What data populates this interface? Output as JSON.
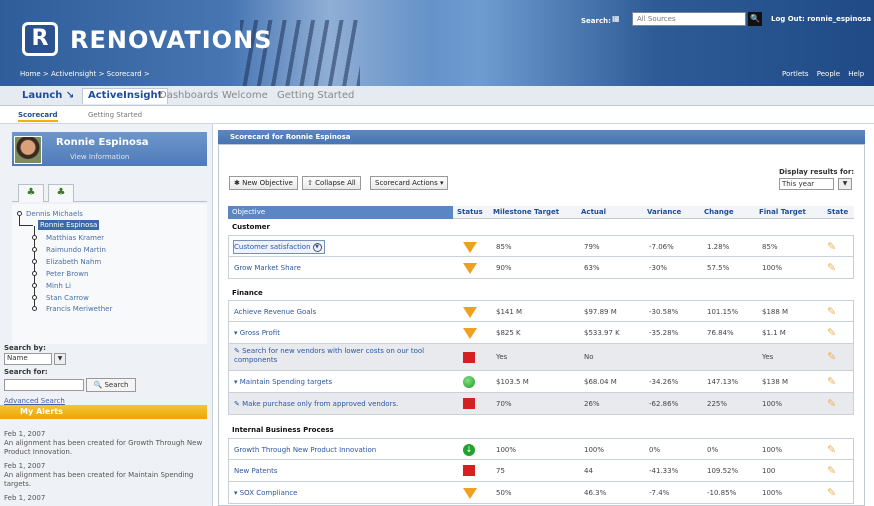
{
  "header": {
    "logo_letter": "R",
    "logo_text": "RENOVATIONS",
    "breadcrumb": "Home > ActiveInsight > Scorecard >",
    "search_label": "Search:",
    "search_placeholder": "All Sources",
    "logout": "Log Out: ronnie_espinosa",
    "links": [
      "Portlets",
      "People",
      "Help"
    ]
  },
  "tabs": {
    "launch": "Launch ↘",
    "items": [
      "ActiveInsight",
      "Dashboards",
      "Welcome",
      "Getting Started"
    ],
    "sub": [
      "Scorecard",
      "Getting Started"
    ]
  },
  "profile": {
    "name": "Ronnie Espinosa",
    "sub": "View Information"
  },
  "tree": {
    "root": "Dennis Michaels",
    "selected": "Ronnie Espinosa",
    "children": [
      "Matthias Kramer",
      "Raimundo Martin",
      "Elizabeth Nahm",
      "Peter Brown",
      "Minh Li",
      "Stan Carrow",
      "Francis Meriwether"
    ]
  },
  "search": {
    "by_label": "Search by:",
    "by_value": "Name",
    "for_label": "Search for:",
    "button": "Search",
    "advanced": "Advanced Search"
  },
  "alerts": {
    "title": "My Alerts",
    "items": [
      {
        "date": "Feb 1, 2007",
        "text": "An alignment has been created for Growth Through New Product Innovation."
      },
      {
        "date": "Feb 1, 2007",
        "text": "An alignment has been created for Maintain Spending targets."
      },
      {
        "date": "Feb 1, 2007",
        "text": ""
      }
    ]
  },
  "main": {
    "title": "Scorecard for Ronnie Espinosa",
    "buttons": [
      "New Objective",
      "Collapse All",
      "Scorecard Actions ▾"
    ],
    "display_label": "Display results for:",
    "display_value": "This year",
    "columns": [
      "Objective",
      "Status",
      "Milestone Target",
      "Actual",
      "Variance",
      "Change",
      "Final Target",
      "State"
    ],
    "sections": [
      {
        "name": "Customer",
        "rows": [
          {
            "objective": "Customer satisfaction",
            "status": "down-triangle",
            "milestone": "85%",
            "actual": "79%",
            "variance": "-7.06%",
            "change": "1.28%",
            "final": "85%"
          },
          {
            "objective": "Grow Market Share",
            "status": "down-triangle",
            "milestone": "90%",
            "actual": "63%",
            "variance": "-30%",
            "change": "57.5%",
            "final": "100%"
          }
        ]
      },
      {
        "name": "Finance",
        "rows": [
          {
            "objective": "Achieve Revenue Goals",
            "status": "down-triangle",
            "milestone": "$141 M",
            "actual": "$97.89 M",
            "variance": "-30.58%",
            "change": "101.15%",
            "final": "$188 M"
          },
          {
            "objective": "▾ Gross Profit",
            "status": "down-triangle",
            "milestone": "$825 K",
            "actual": "$533.97 K",
            "variance": "-35.28%",
            "change": "76.84%",
            "final": "$1.1 M"
          },
          {
            "objective": "Search for new vendors with lower costs on our tool components",
            "status": "red-square",
            "milestone": "Yes",
            "actual": "No",
            "variance": "",
            "change": "",
            "final": "Yes"
          },
          {
            "objective": "▾ Maintain Spending targets",
            "status": "green-circle",
            "milestone": "$103.5 M",
            "actual": "$68.04 M",
            "variance": "-34.26%",
            "change": "147.13%",
            "final": "$138 M"
          },
          {
            "objective": "Make purchase only from approved vendors.",
            "status": "red-square",
            "milestone": "70%",
            "actual": "26%",
            "variance": "-62.86%",
            "change": "225%",
            "final": "100%"
          }
        ]
      },
      {
        "name": "Internal Business Process",
        "rows": [
          {
            "objective": "Growth Through New Product Innovation",
            "status": "green-down-arrow",
            "milestone": "100%",
            "actual": "100%",
            "variance": "0%",
            "change": "0%",
            "final": "100%"
          },
          {
            "objective": "New Patents",
            "status": "red-square",
            "milestone": "75",
            "actual": "44",
            "variance": "-41.33%",
            "change": "109.52%",
            "final": "100"
          },
          {
            "objective": "▾ SOX Compliance",
            "status": "down-triangle",
            "milestone": "50%",
            "actual": "46.3%",
            "variance": "-7.4%",
            "change": "-10.85%",
            "final": "100%"
          }
        ]
      }
    ]
  },
  "colors": {
    "accent": "#4774b2",
    "status_amber": "#f0a020",
    "status_red": "#d42020",
    "status_green": "#23a12e",
    "alert_bar": "#f0b400"
  }
}
